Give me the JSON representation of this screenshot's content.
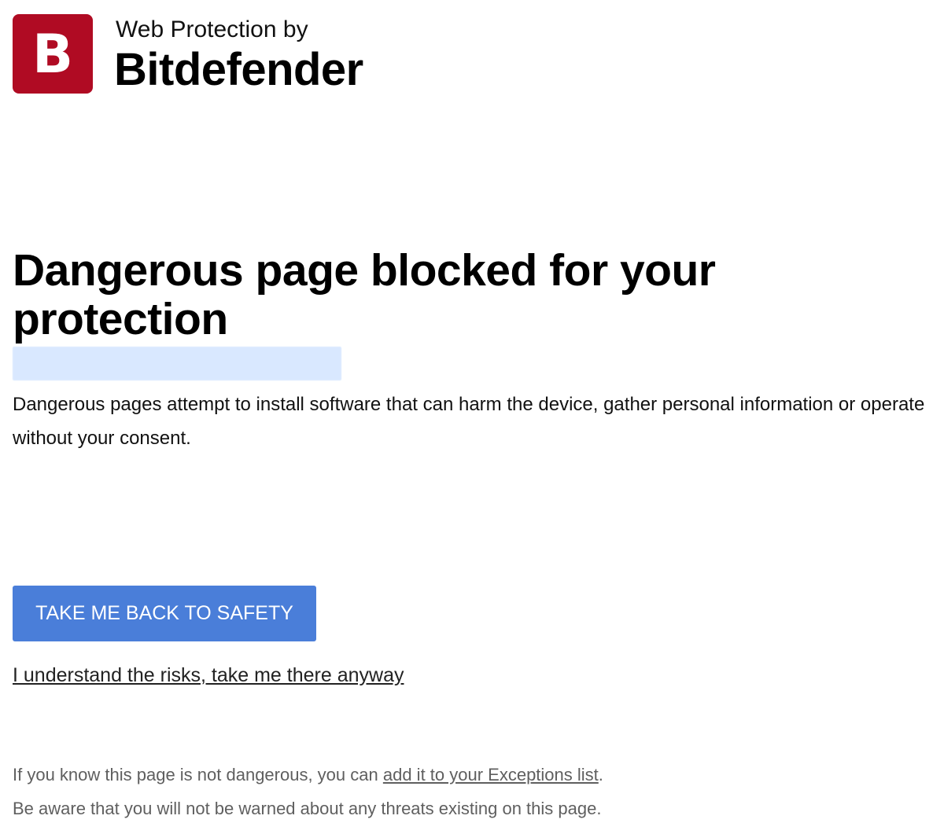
{
  "header": {
    "logo_icon": "bitdefender-b-logo",
    "logo_letter": "B",
    "subtitle": "Web Protection by",
    "brand": "Bitdefender"
  },
  "colors": {
    "brand_red": "#b00b23",
    "button_blue": "#4a7ed9",
    "url_highlight": "#d9e8ff",
    "muted_text": "#5f5f5f"
  },
  "main": {
    "title": "Dangerous page blocked for your protection",
    "blocked_url": "",
    "description": "Dangerous pages attempt to install software that can harm the device, gather personal information or operate without your consent.",
    "safety_button": "TAKE ME BACK TO SAFETY",
    "proceed_link": "I understand the risks, take me there anyway"
  },
  "footer": {
    "line1_prefix": "If you know this page is not dangerous, you can ",
    "line1_link": "add it to your Exceptions list",
    "line1_suffix": ".",
    "line2": "Be aware that you will not be warned about any threats existing on this page."
  }
}
